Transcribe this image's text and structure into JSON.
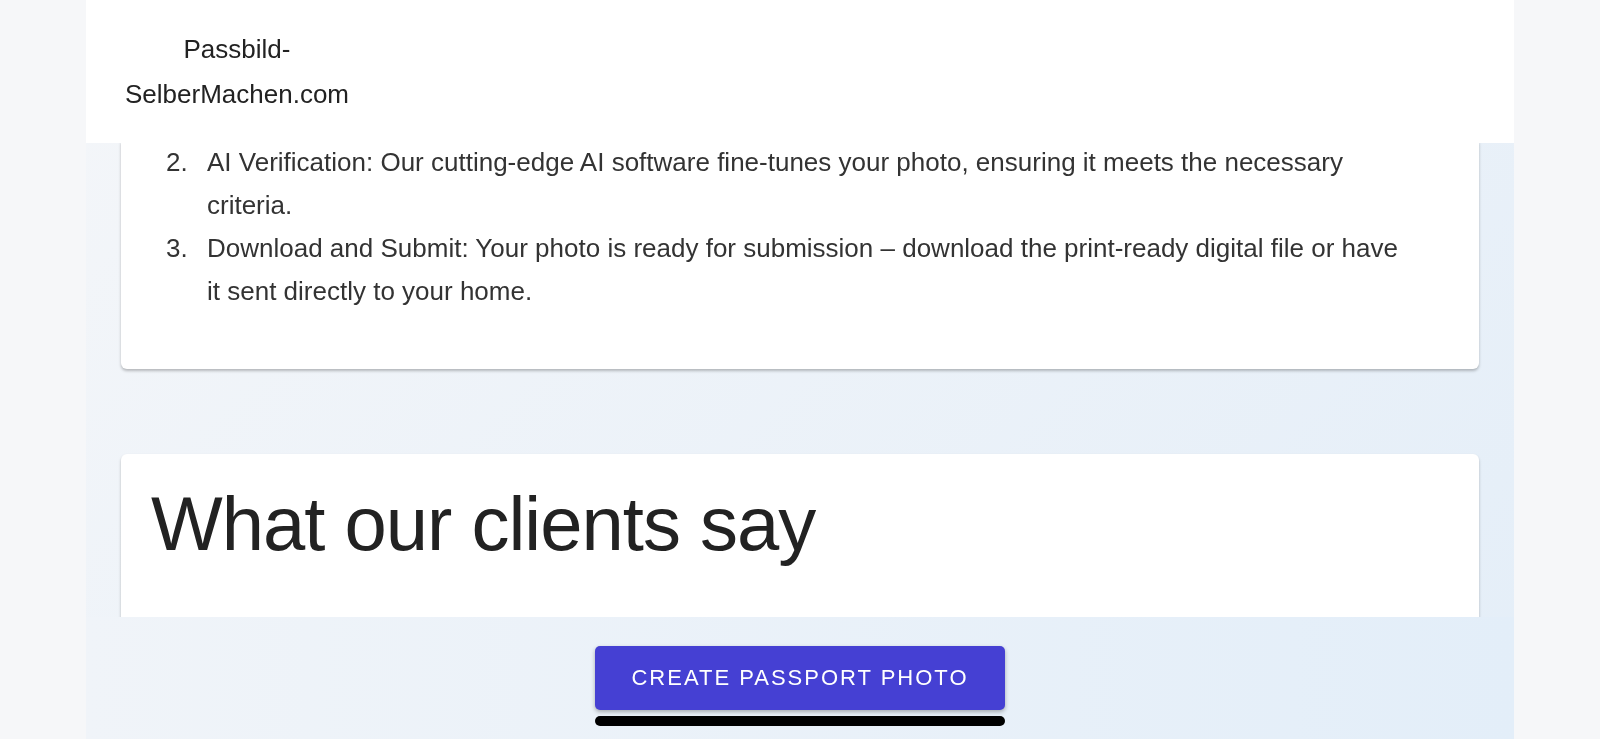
{
  "header": {
    "logo": "Passbild-SelberMachen.com"
  },
  "steps": [
    {
      "number": "2.",
      "text": "AI Verification: Our cutting-edge AI software fine-tunes your photo, ensuring it meets the necessary criteria."
    },
    {
      "number": "3.",
      "text": "Download and Submit: Your photo is ready for submission – download the print-ready digital file or have it sent directly to your home."
    }
  ],
  "testimonials": {
    "heading": "What our clients say"
  },
  "cta": {
    "label": "CREATE PASSPORT PHOTO"
  }
}
